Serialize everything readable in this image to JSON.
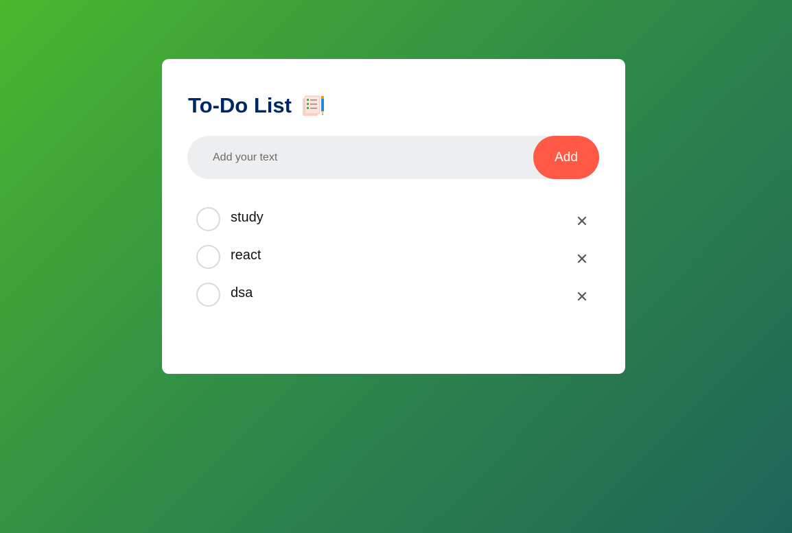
{
  "app": {
    "title": "To-Do List",
    "title_icon": "checklist-notepad-icon"
  },
  "input": {
    "placeholder": "Add your text",
    "value": ""
  },
  "add_button": {
    "label": "Add"
  },
  "todos": [
    {
      "text": "study",
      "done": false
    },
    {
      "text": "react",
      "done": false
    },
    {
      "text": "dsa",
      "done": false
    }
  ],
  "colors": {
    "title": "#002765",
    "accent": "#ff5945",
    "input_bg": "#edeef0",
    "bg_start": "#4ab72e",
    "bg_end": "#206459"
  }
}
